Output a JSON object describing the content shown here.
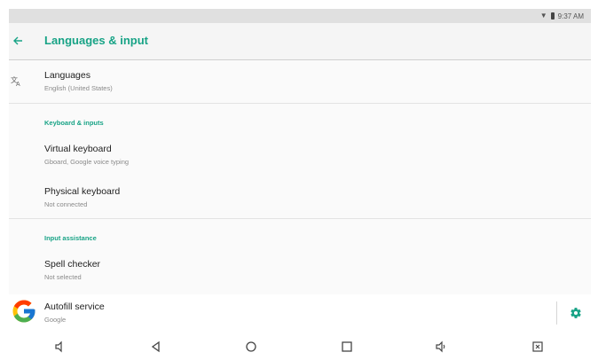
{
  "status_bar": {
    "time": "9:37 AM"
  },
  "app_bar": {
    "title": "Languages & input"
  },
  "languages": {
    "title": "Languages",
    "summary": "English (United States)"
  },
  "keyboard_section": {
    "header": "Keyboard & inputs",
    "virtual_keyboard": {
      "title": "Virtual keyboard",
      "summary": "Gboard, Google voice typing"
    },
    "physical_keyboard": {
      "title": "Physical keyboard",
      "summary": "Not connected"
    }
  },
  "assistance_section": {
    "header": "Input assistance",
    "spell_checker": {
      "title": "Spell checker",
      "summary": "Not selected"
    },
    "autofill": {
      "title": "Autofill service",
      "summary": "Google"
    }
  },
  "icons": {
    "back": "back-arrow-icon",
    "language": "translate-icon",
    "autofill_app": "google-g-icon",
    "settings": "gear-icon",
    "nav": [
      "volume-down-icon",
      "back-triangle-icon",
      "home-circle-icon",
      "recents-square-icon",
      "volume-up-icon",
      "screenshot-icon"
    ]
  },
  "colors": {
    "accent": "#18a386",
    "status_bar_bg": "#e0e0e0",
    "app_bar_bg": "#f5f5f5"
  }
}
